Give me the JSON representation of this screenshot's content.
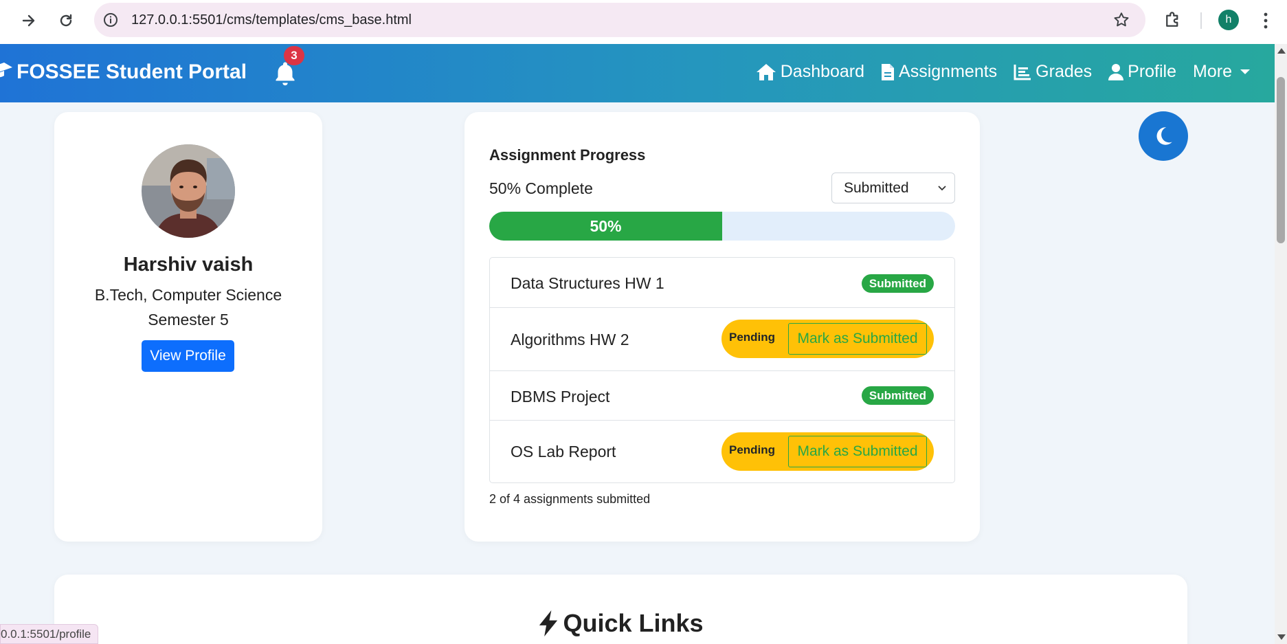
{
  "browser": {
    "url": "127.0.0.1:5501/cms/templates/cms_base.html",
    "profile_initial": "h",
    "status_url": "0.0.1:5501/profile"
  },
  "navbar": {
    "brand": "FOSSEE Student Portal",
    "notification_count": "3",
    "links": [
      {
        "label": "Dashboard",
        "icon": "home-icon"
      },
      {
        "label": "Assignments",
        "icon": "file-icon"
      },
      {
        "label": "Grades",
        "icon": "chart-icon"
      },
      {
        "label": "Profile",
        "icon": "user-icon"
      },
      {
        "label": "More",
        "icon": "caret-down-icon"
      }
    ]
  },
  "profile": {
    "name": "Harshiv vaish",
    "degree": "B.Tech, Computer Science",
    "semester": "Semester 5",
    "view_button": "View Profile"
  },
  "progress": {
    "title": "Assignment Progress",
    "complete_text": "50% Complete",
    "filter_selected": "Submitted",
    "percent": 50,
    "percent_label": "50%",
    "assignments": [
      {
        "name": "Data Structures HW 1",
        "status": "Submitted"
      },
      {
        "name": "Algorithms HW 2",
        "status": "Pending",
        "action": "Mark as Submitted"
      },
      {
        "name": "DBMS Project",
        "status": "Submitted"
      },
      {
        "name": "OS Lab Report",
        "status": "Pending",
        "action": "Mark as Submitted"
      }
    ],
    "summary": "2 of 4 assignments submitted"
  },
  "quick_links": {
    "title": "Quick Links"
  },
  "colors": {
    "primary": "#0d6efd",
    "success": "#28a745",
    "warning": "#ffc107",
    "danger": "#dc3545",
    "theme_toggle": "#1976d2"
  }
}
